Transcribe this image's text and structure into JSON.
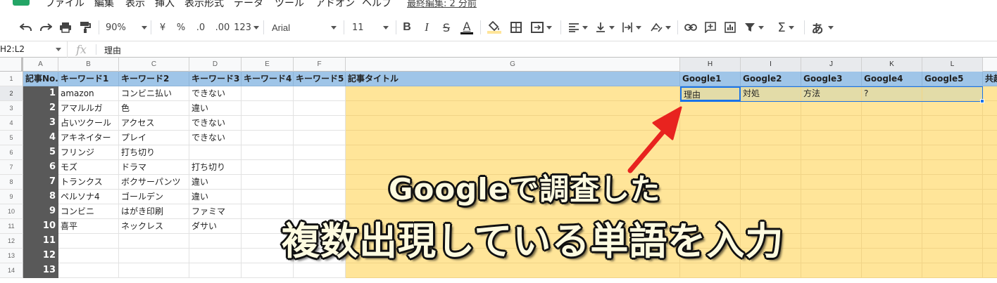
{
  "menu": {
    "items": [
      "ファイル",
      "編集",
      "表示",
      "挿入",
      "表示形式",
      "データ",
      "ツール",
      "アドオン",
      "ヘルプ"
    ],
    "last_edit": "最終編集: 2 分前"
  },
  "toolbar": {
    "zoom": "90%",
    "currency": "¥",
    "percent": "%",
    "decimal_less": ".0",
    "decimal_more": ".00",
    "more_formats": "123",
    "font": "Arial",
    "font_size": "11",
    "bold": "B",
    "italic": "I",
    "strike": "S",
    "text_color": "A",
    "input_tools": "あ",
    "text_color_hex": "#000000",
    "fill_color_hex": "#ffe599"
  },
  "formula_bar": {
    "name_box": "H2:L2",
    "fx": "fx",
    "value": "理由"
  },
  "columns": [
    {
      "label": "A"
    },
    {
      "label": "B"
    },
    {
      "label": "C"
    },
    {
      "label": "D"
    },
    {
      "label": "E"
    },
    {
      "label": "F"
    },
    {
      "label": "G"
    },
    {
      "label": "H"
    },
    {
      "label": "I"
    },
    {
      "label": "J"
    },
    {
      "label": "K"
    },
    {
      "label": "L"
    },
    {
      "label": ""
    }
  ],
  "header_row": [
    "記事No.",
    "キーワード1",
    "キーワード2",
    "キーワード3",
    "キーワード4",
    "キーワード5",
    "記事タイトル",
    "Google1",
    "Google2",
    "Google3",
    "Google4",
    "Google5",
    "共起"
  ],
  "rows": [
    {
      "n": "2",
      "num": "1",
      "b": "amazon",
      "c": "コンビニ払い",
      "d": "できない",
      "h": "理由",
      "i": "対処",
      "j": "方法",
      "k": "?",
      "l": ""
    },
    {
      "n": "3",
      "num": "2",
      "b": "アマルルガ",
      "c": "色",
      "d": "違い"
    },
    {
      "n": "4",
      "num": "3",
      "b": "占いツクール",
      "c": "アクセス",
      "d": "できない"
    },
    {
      "n": "5",
      "num": "4",
      "b": "アキネイター",
      "c": "プレイ",
      "d": "できない"
    },
    {
      "n": "6",
      "num": "5",
      "b": "フリンジ",
      "c": "打ち切り",
      "d": ""
    },
    {
      "n": "7",
      "num": "6",
      "b": "モズ",
      "c": "ドラマ",
      "d": "打ち切り"
    },
    {
      "n": "8",
      "num": "7",
      "b": "トランクス",
      "c": "ボクサーパンツ",
      "d": "違い"
    },
    {
      "n": "9",
      "num": "8",
      "b": "ペルソナ4",
      "c": "ゴールデン",
      "d": "違い"
    },
    {
      "n": "10",
      "num": "9",
      "b": "コンビニ",
      "c": "はがき印刷",
      "d": "ファミマ"
    },
    {
      "n": "11",
      "num": "10",
      "b": "喜平",
      "c": "ネックレス",
      "d": "ダサい"
    },
    {
      "n": "12",
      "num": "11",
      "b": "",
      "c": "",
      "d": ""
    },
    {
      "n": "13",
      "num": "12",
      "b": "",
      "c": "",
      "d": ""
    },
    {
      "n": "14",
      "num": "13",
      "b": "",
      "c": "",
      "d": ""
    }
  ],
  "annotation": {
    "line1": "Googleで調査した",
    "line2": "複数出現している単語を入力",
    "arrow_color": "#e8231f"
  }
}
